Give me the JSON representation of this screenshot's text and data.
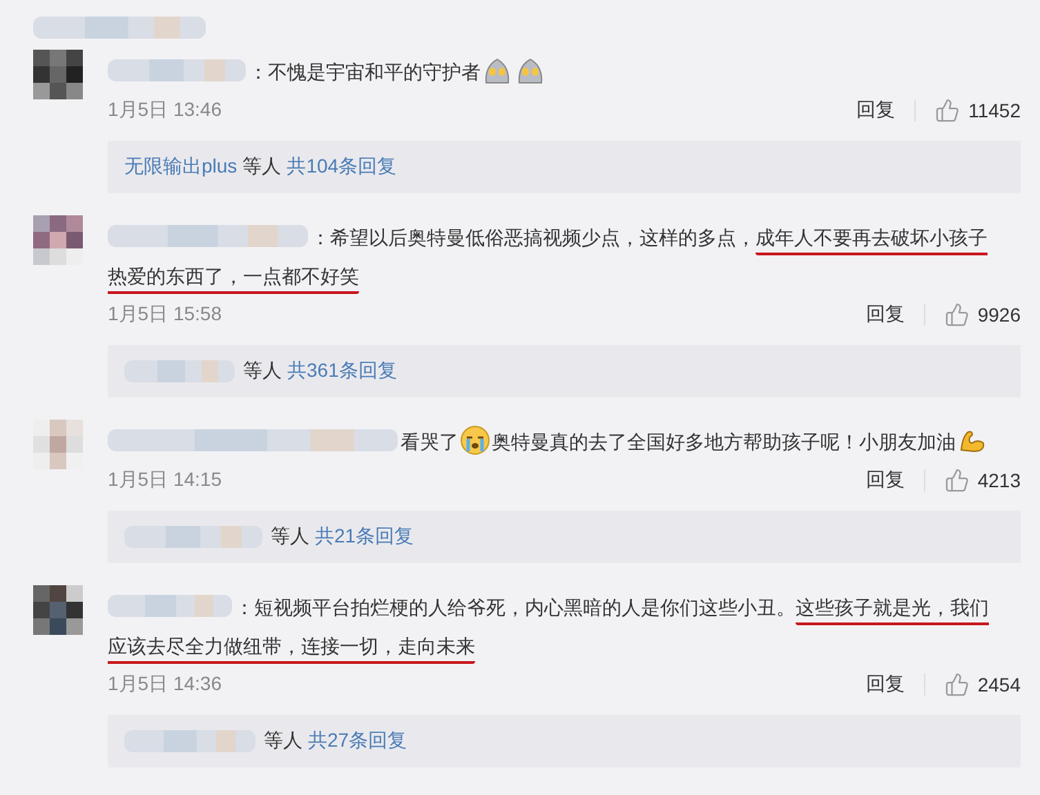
{
  "comments": [
    {
      "text": [
        {
          "kind": "text",
          "text": "：不愧是宇宙和平的守护者",
          "underlined": false
        },
        {
          "kind": "helmet"
        },
        {
          "kind": "helmet"
        }
      ],
      "time": "1月5日 13:46",
      "reply_label": "回复",
      "likes": "11452",
      "replies": {
        "named_user": "无限输出plus",
        "others": "等人",
        "count": "共104条回复"
      }
    },
    {
      "text": [
        {
          "kind": "text",
          "text": "：希望以后奥特曼低俗恶搞视频少点，这样的多点，",
          "underlined": false
        },
        {
          "kind": "text",
          "text": "成年人不要再去破坏小孩子热爱的东西了，一点都不好笑",
          "underlined": true
        }
      ],
      "time": "1月5日 15:58",
      "reply_label": "回复",
      "likes": "9926",
      "replies": {
        "others": "等人",
        "count": "共361条回复"
      }
    },
    {
      "text": [
        {
          "kind": "text",
          "text": "看哭了",
          "underlined": false
        },
        {
          "kind": "crying"
        },
        {
          "kind": "text",
          "text": "奥特曼真的去了全国好多地方帮助孩子呢！小朋友加油",
          "underlined": false
        },
        {
          "kind": "arm"
        }
      ],
      "time": "1月5日 14:15",
      "reply_label": "回复",
      "likes": "4213",
      "replies": {
        "others": "等人",
        "count": "共21条回复"
      }
    },
    {
      "text": [
        {
          "kind": "text",
          "text": "：短视频平台拍烂梗的人给爷死，内心黑暗的人是你们这些小丑。",
          "underlined": false
        },
        {
          "kind": "text",
          "text": "这些孩子就是光，我们应该去尽全力做纽带，连接一切，走向未来",
          "underlined": true
        }
      ],
      "time": "1月5日 14:36",
      "reply_label": "回复",
      "likes": "2454",
      "replies": {
        "others": "等人",
        "count": "共27条回复"
      }
    }
  ]
}
